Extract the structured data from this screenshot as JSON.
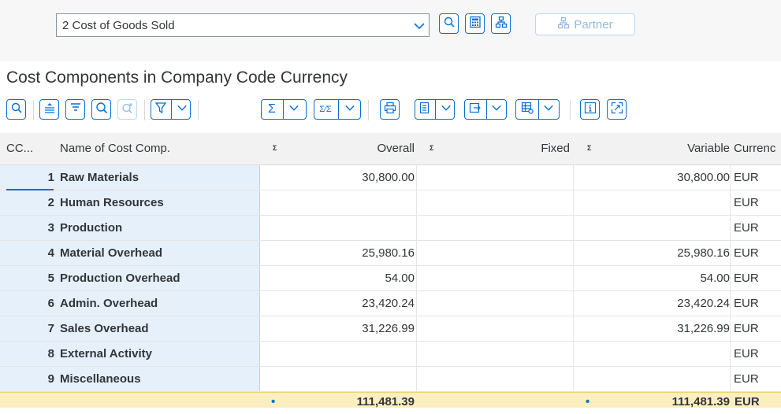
{
  "header": {
    "select_value": "2 Cost of Goods Sold",
    "partner_label": "Partner",
    "icons": [
      "chevron-down-icon",
      "zoom-icon",
      "calculator-icon",
      "hierarchy-icon",
      "partner-icon"
    ]
  },
  "section": {
    "title": "Cost Components in Company Code Currency"
  },
  "toolbar": {
    "icons": [
      "zoom-icon",
      "align-icon",
      "filter-lines-icon",
      "search-icon",
      "search-next-icon",
      "filter-icon",
      "sum-icon",
      "subtotal-icon",
      "print-icon",
      "export-icon",
      "views-icon",
      "layout-icon",
      "info-icon",
      "fullscreen-icon"
    ]
  },
  "table": {
    "columns": {
      "cc": "CC...",
      "name": "Name of Cost Comp.",
      "overall": "Overall",
      "fixed": "Fixed",
      "variable": "Variable",
      "currency": "Currenc",
      "sum_marker": "Σ"
    },
    "rows": [
      {
        "cc": "1",
        "name": "Raw Materials",
        "overall": "30,800.00",
        "fixed": "",
        "variable": "30,800.00",
        "currency": "EUR"
      },
      {
        "cc": "2",
        "name": "Human Resources",
        "overall": "",
        "fixed": "",
        "variable": "",
        "currency": "EUR"
      },
      {
        "cc": "3",
        "name": "Production",
        "overall": "",
        "fixed": "",
        "variable": "",
        "currency": "EUR"
      },
      {
        "cc": "4",
        "name": "Material Overhead",
        "overall": "25,980.16",
        "fixed": "",
        "variable": "25,980.16",
        "currency": "EUR"
      },
      {
        "cc": "5",
        "name": "Production Overhead",
        "overall": "54.00",
        "fixed": "",
        "variable": "54.00",
        "currency": "EUR"
      },
      {
        "cc": "6",
        "name": "Admin. Overhead",
        "overall": "23,420.24",
        "fixed": "",
        "variable": "23,420.24",
        "currency": "EUR"
      },
      {
        "cc": "7",
        "name": "Sales Overhead",
        "overall": "31,226.99",
        "fixed": "",
        "variable": "31,226.99",
        "currency": "EUR"
      },
      {
        "cc": "8",
        "name": "External Activity",
        "overall": "",
        "fixed": "",
        "variable": "",
        "currency": "EUR"
      },
      {
        "cc": "9",
        "name": "Miscellaneous",
        "overall": "",
        "fixed": "",
        "variable": "",
        "currency": "EUR"
      }
    ],
    "total": {
      "marker": "•",
      "overall": "111,481.39",
      "variable": "111,481.39",
      "currency": "EUR"
    }
  },
  "colors": {
    "accent": "#0a6ed1",
    "key_column": "#e5f0fa",
    "total_row": "#fcefbf"
  }
}
